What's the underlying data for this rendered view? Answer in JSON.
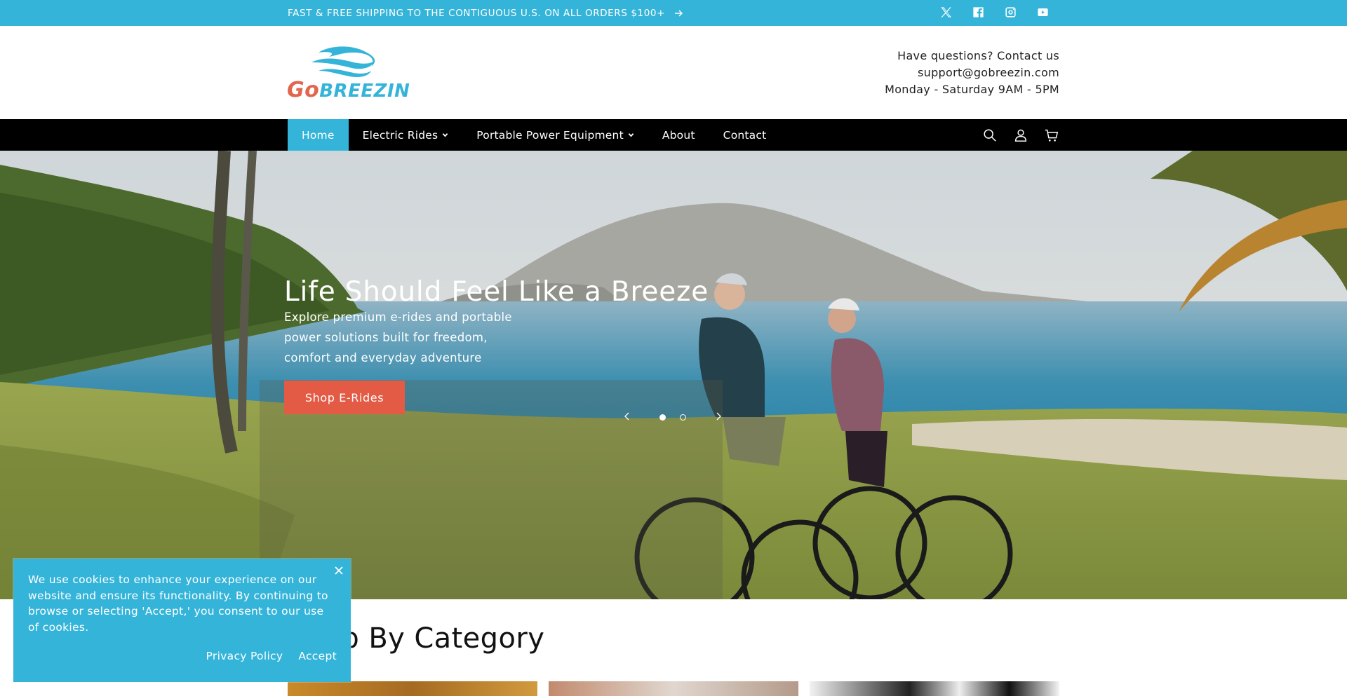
{
  "announcement": {
    "text": "FAST & FREE SHIPPING TO THE CONTIGUOUS U.S. ON ALL ORDERS $100+",
    "arrow_icon": "arrow-right-icon"
  },
  "social": [
    {
      "name": "x-icon"
    },
    {
      "name": "facebook-icon"
    },
    {
      "name": "instagram-icon"
    },
    {
      "name": "youtube-icon"
    }
  ],
  "header": {
    "logo": {
      "part1": "Go",
      "part2": "Breezin"
    },
    "contact": {
      "line1": "Have questions? Contact us",
      "email": "support@gobreezin.com",
      "hours": "Monday - Saturday 9AM - 5PM"
    }
  },
  "nav": {
    "items": [
      {
        "label": "Home",
        "active": true
      },
      {
        "label": "Electric Rides",
        "dropdown": true
      },
      {
        "label": "Portable Power Equipment",
        "dropdown": true
      },
      {
        "label": "About"
      },
      {
        "label": "Contact"
      }
    ],
    "icons": [
      "search-icon",
      "account-icon",
      "cart-icon"
    ]
  },
  "hero": {
    "title": "Life Should Feel Like a Breeze",
    "subtitle": "Explore premium e-rides and portable power solutions built for freedom, comfort and everyday adventure",
    "button": "Shop E-Rides",
    "slides": 2,
    "active_slide": 1
  },
  "category": {
    "title": "Shop By Category"
  },
  "cookie": {
    "text": "We use cookies to enhance your experience on our website and ensure its functionality. By continuing to browse or selecting 'Accept,' you consent to our use of cookies.",
    "privacy": "Privacy Policy",
    "accept": "Accept"
  },
  "colors": {
    "brand_blue": "#35b4da",
    "cta_red": "#e35a45",
    "nav_bg": "#000000",
    "logo_orange": "#e2654e"
  }
}
